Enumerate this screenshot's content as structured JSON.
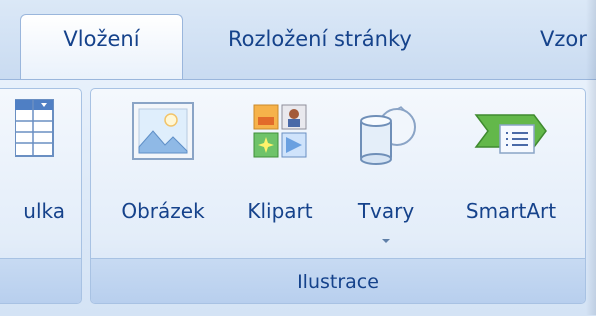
{
  "tabs": {
    "active": "Vložení",
    "items": [
      "Rozložení stránky",
      "Vzor"
    ]
  },
  "groups": {
    "table": {
      "button_label": "ulka"
    },
    "illustrations": {
      "label": "Ilustrace",
      "buttons": {
        "picture": "Obrázek",
        "clipart": "Klipart",
        "shapes": "Tvary",
        "smartart": "SmartArt"
      }
    }
  },
  "icons": {
    "table": "table-icon",
    "picture": "picture-icon",
    "clipart": "clipart-icon",
    "shapes": "shapes-icon",
    "smartart": "smartart-icon",
    "dropdown": "dropdown-arrow-icon"
  },
  "colors": {
    "text": "#15428b",
    "ribbon_bg": "#dfe9f7",
    "group_border": "#a8c2e3"
  }
}
